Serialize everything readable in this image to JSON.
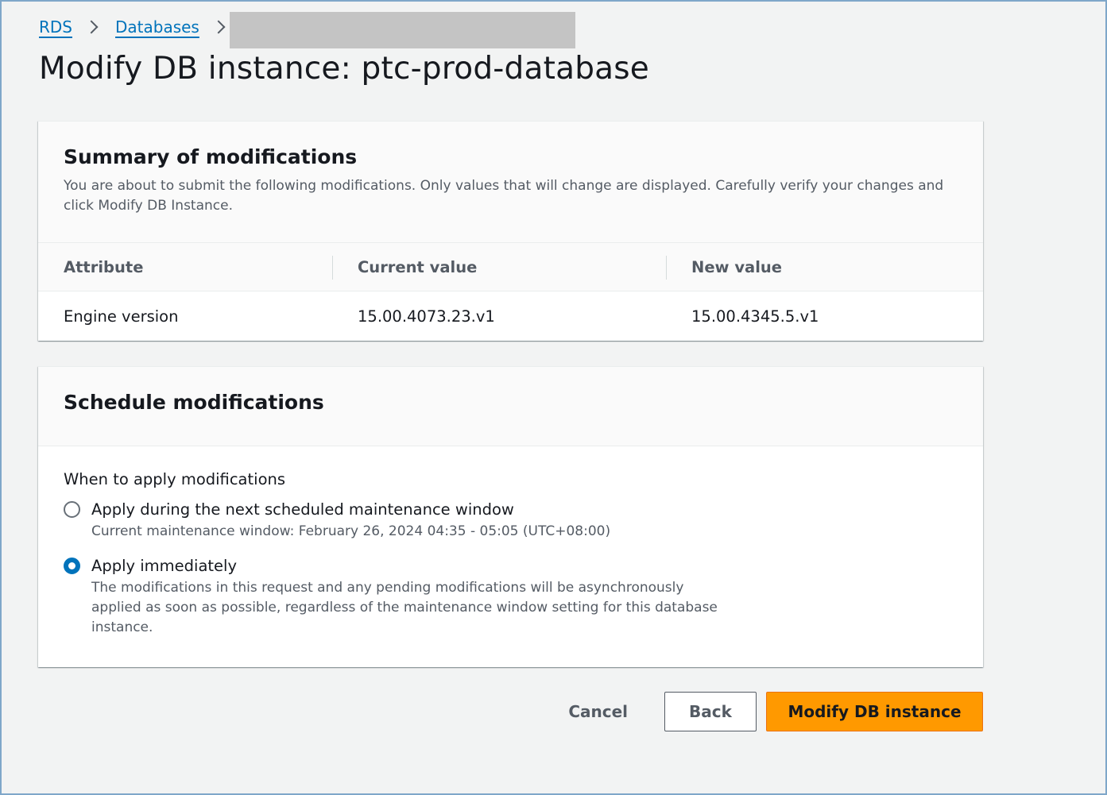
{
  "breadcrumb": {
    "items": [
      {
        "label": "RDS"
      },
      {
        "label": "Databases"
      }
    ]
  },
  "page": {
    "title": "Modify DB instance: ptc-prod-database"
  },
  "summary": {
    "title": "Summary of modifications",
    "description": "You are about to submit the following modifications. Only values that will change are displayed. Carefully verify your changes and click Modify DB Instance.",
    "columns": [
      "Attribute",
      "Current value",
      "New value"
    ],
    "rows": [
      {
        "attribute": "Engine version",
        "current": "15.00.4073.23.v1",
        "new": "15.00.4345.5.v1"
      }
    ]
  },
  "schedule": {
    "title": "Schedule modifications",
    "field_label": "When to apply modifications",
    "options": [
      {
        "label": "Apply during the next scheduled maintenance window",
        "description": "Current maintenance window: February 26, 2024 04:35 - 05:05 (UTC+08:00)",
        "selected": false
      },
      {
        "label": "Apply immediately",
        "description": "The modifications in this request and any pending modifications will be asynchronously applied as soon as possible, regardless of the maintenance window setting for this database instance.",
        "selected": true
      }
    ]
  },
  "actions": {
    "cancel_label": "Cancel",
    "back_label": "Back",
    "submit_label": "Modify DB instance"
  },
  "colors": {
    "link": "#0073bb",
    "primary_button": "#ff9900",
    "background": "#f2f3f3"
  }
}
